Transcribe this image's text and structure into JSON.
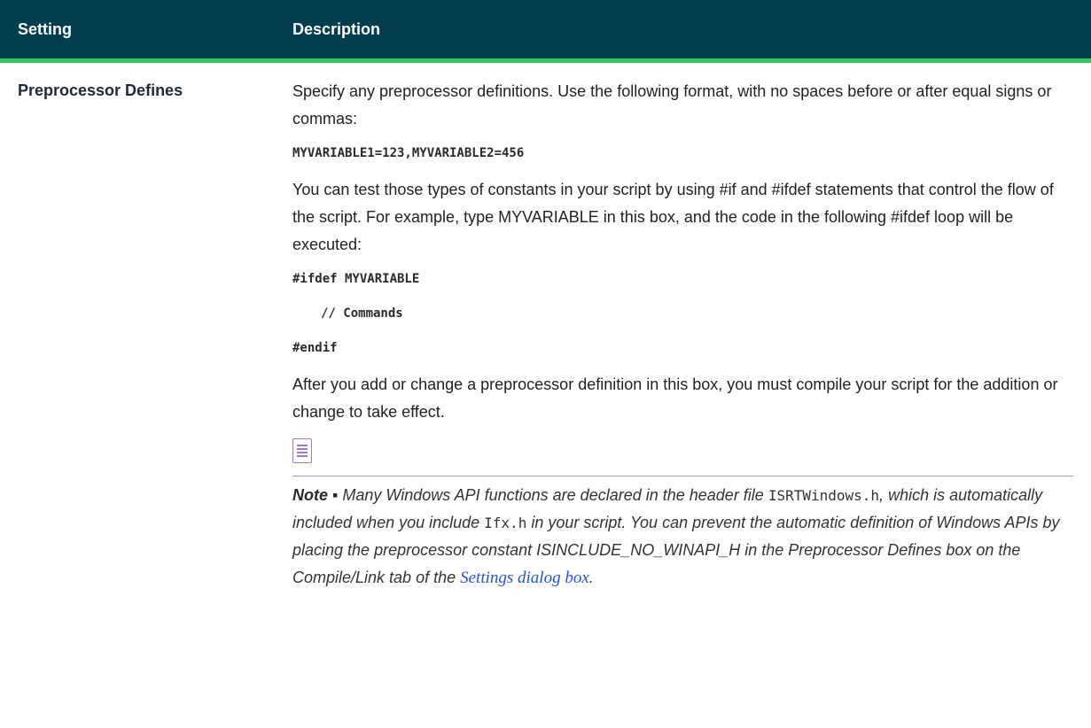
{
  "table": {
    "headers": {
      "setting": "Setting",
      "description": "Description"
    },
    "rows": [
      {
        "setting": "Preprocessor Defines",
        "paragraph1": "Specify any preprocessor definitions. Use the following format, with no spaces before or after equal signs or commas:",
        "code_example": "MYVARIABLE1=123,MYVARIABLE2=456",
        "paragraph2": "You can test those types of constants in your script by using #if and #ifdef statements that control the flow of the script. For example, type MYVARIABLE in this box, and the code in the following #ifdef loop will be executed:",
        "code_ifdef": "#ifdef MYVARIABLE",
        "code_comment": "// Commands",
        "code_endif": "#endif",
        "paragraph3": "After you add or change a preprocessor definition in this box, you must compile your script for the addition or change to take effect.",
        "note": {
          "icon": "note-icon",
          "label": "Note",
          "separator": " ▪ ",
          "text1": "Many Windows API functions are declared in the header file ",
          "file1": "ISRTWindows.h",
          "text2": ", which is automatically included when you include ",
          "file2": "Ifx.h",
          "text3": " in your script. You can prevent the automatic definition of Windows APIs by placing the preprocessor constant ISINCLUDE_NO_WINAPI_H in the Preprocessor Defines box on the Compile/Link tab of the ",
          "link_text": "Settings dialog box",
          "text4": "."
        }
      }
    ]
  },
  "colors": {
    "header_bg": "#003d4f",
    "header_accent": "#2fc75b",
    "link": "#2255cc",
    "note_icon": "#9b7fb6"
  }
}
